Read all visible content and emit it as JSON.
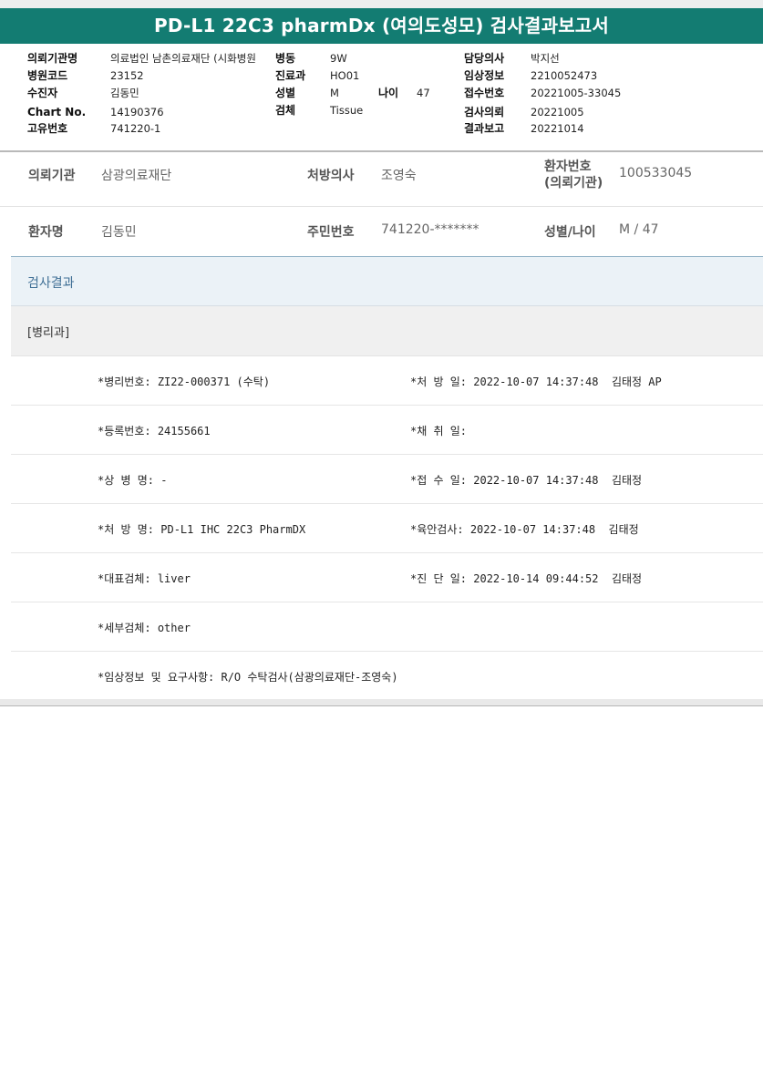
{
  "title": "PD-L1 22C3 pharmDx (여의도성모) 검사결과보고서",
  "header_info": {
    "institution_label": "의뢰기관명",
    "institution_value": "의료법인 남촌의료재단 (시화병원",
    "ward_label": "병동",
    "ward_value": "9W",
    "doctor_label": "담당의사",
    "doctor_value": "박지선",
    "hospital_code_label": "병원코드",
    "hospital_code_value": "23152",
    "dept_label": "진료과",
    "dept_value": "HO01",
    "clinical_info_label": "임상정보",
    "clinical_info_value": "2210052473",
    "patient_label": "수진자",
    "patient_value": "김동민",
    "sex_label": "성별",
    "sex_value": "M",
    "age_label": "나이",
    "age_value": "47",
    "receipt_label": "접수번호",
    "receipt_value": "20221005-33045",
    "chart_label": "Chart No.",
    "chart_value": "14190376",
    "specimen_label": "검체",
    "specimen_value": "Tissue",
    "request_label": "검사의뢰",
    "request_value": "20221005",
    "unique_label": "고유번호",
    "unique_value": "741220-1",
    "report_label": "결과보고",
    "report_value": "20221014"
  },
  "patient_block": {
    "institution_label": "의뢰기관",
    "institution_value": "삼광의료재단",
    "doctor_label": "처방의사",
    "doctor_value": "조영숙",
    "patient_no_label_line1": "환자번호",
    "patient_no_label_line2": "(의뢰기관)",
    "patient_no_value": "100533045",
    "name_label": "환자명",
    "name_value": "김동민",
    "rrn_label": "주민번호",
    "rrn_value": "741220-*******",
    "sex_age_label": "성별/나이",
    "sex_age_value": "M / 47"
  },
  "results": {
    "section_title": "검사결과",
    "department": "[병리과]",
    "rows": [
      {
        "left": "*병리번호: ZI22-000371 (수탁)",
        "right": "*처 방 일: 2022-10-07 14:37:48  김태정 AP"
      },
      {
        "left": "*등록번호: 24155661",
        "right": "*채 취 일:"
      },
      {
        "left": "*상 병 명: -",
        "right": "*접 수 일: 2022-10-07 14:37:48  김태정"
      },
      {
        "left": "*처 방 명: PD-L1 IHC 22C3 PharmDX",
        "right": "*육안검사: 2022-10-07 14:37:48  김태정"
      },
      {
        "left": "*대표검체: liver",
        "right": "*진 단 일: 2022-10-14 09:44:52  김태정"
      },
      {
        "left": "*세부검체: other",
        "right": ""
      },
      {
        "left": "*임상정보 및 요구사항: R/O 수탁검사(삼광의료재단-조영숙)",
        "right": ""
      }
    ]
  }
}
